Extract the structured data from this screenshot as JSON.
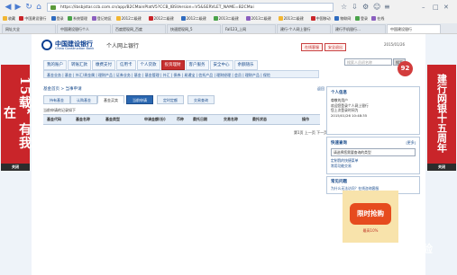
{
  "browser": {
    "address": "https://ibsbjstar.ccb.com.cn/app/B2CMainPlatV5?CCB_IBSVersion=V5&SERVLET_NAME=B2CMai",
    "bookmarks": [
      "收藏",
      "中国建设银行",
      "登录",
      "系统管理",
      "登记地区",
      "2012二级建",
      "2012二级建",
      "2012二级建",
      "2013二级建",
      "2013二级建",
      "2013二级建",
      "中国移动",
      "物联网",
      "登录",
      "在线"
    ],
    "tabs": [
      "网址大全",
      "中国建设银行个人",
      "百度提现网_百度",
      "快速提现网_5",
      "Fal123_上网",
      "建行-个人网上银行",
      "建行手机银行…",
      "中国建设银行"
    ]
  },
  "header": {
    "bank_name_cn": "中国建设银行",
    "bank_name_en": "China Construction Bank",
    "site_name": "个人网上银行",
    "top_buttons": [
      "在线客服",
      "安全退出"
    ],
    "date": "2015/01/26",
    "search_placeholder": "搜索人员初名称",
    "search_button": "搜索",
    "notif_count": "92"
  },
  "nav": {
    "items": [
      "我的账户",
      "转账汇款",
      "缴费支付",
      "信用卡",
      "个人贷款",
      "投资理财",
      "客户服务",
      "安全中心",
      "余额随乐"
    ],
    "active_index": 5,
    "subnav": "基金业务 | 基金 | 外汇/贵金属 | 理财产品 | 证券业务 | 基金 | 基金管理 | 外汇 | 债券 | 易通宝 | 信托产品 | 理财经理 | 会员 | 理财产品 | 保险"
  },
  "content": {
    "breadcrumb": "基金首页 > 当事申请",
    "back_label": "返回",
    "tabs": [
      "持有基金",
      "认购基金",
      "基金买卖",
      "当前申请",
      "定时定额",
      "交易查询"
    ],
    "hint": "当前申请的记录如下",
    "columns": [
      "基金代码",
      "基金名称",
      "基金类型",
      "申请金额(份)",
      "币种",
      "委托日期",
      "交易名称",
      "委托状态",
      "操作"
    ],
    "pager": "第1页 上一页 下一页"
  },
  "right": {
    "welcome_title": "个人信息",
    "welcome_lines": [
      "尊敬的用户",
      "欢迎您登录个人网上银行",
      "您上次登录时间为",
      "2015/01/26 10:48:35"
    ],
    "quick_title": "快速查询",
    "quick_action": "[更多]",
    "quick_select": "请选择您需要查询的类型",
    "quick_links": [
      "定制我的快捷菜单",
      "常用功能交易"
    ],
    "tips_title": "常见问题",
    "tips_text": "为什么无法访问？在线咨询客服",
    "promo_text": "限时抢购",
    "promo_sub": "最高10%"
  },
  "ads": {
    "left_text": "15载，有我在",
    "right_text": "建行网银十五周年",
    "close_label": "关闭"
  },
  "watermark": "Fiatcu 经验"
}
